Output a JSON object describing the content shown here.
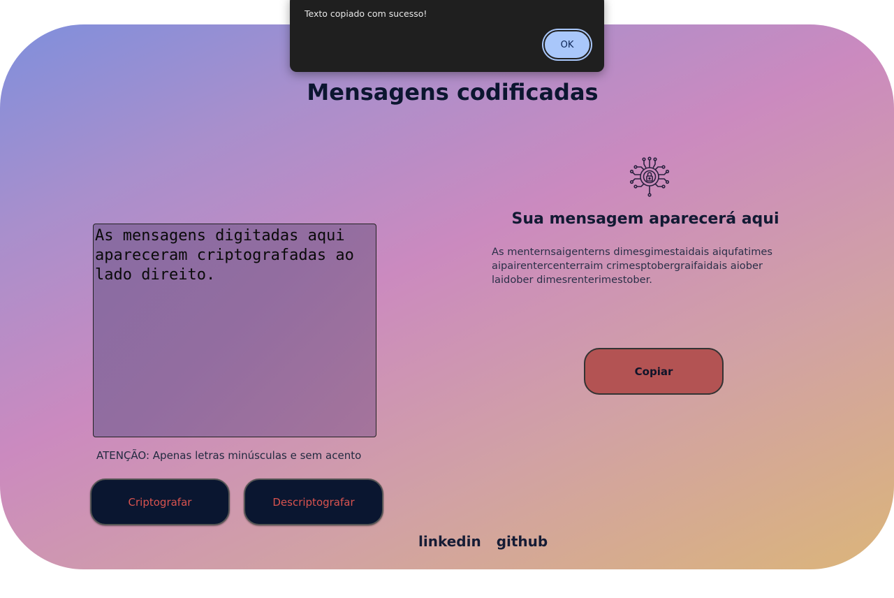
{
  "page": {
    "title": "Mensagens codificadas"
  },
  "input": {
    "value": "As mensagens digitadas aqui apareceram criptografadas ao lado direito."
  },
  "warning": "ATENÇÃO: Apenas letras minúsculas e sem acento",
  "buttons": {
    "encrypt": "Criptografar",
    "decrypt": "Descriptografar",
    "copy": "Copiar"
  },
  "result": {
    "icon": "circuit-lock-icon",
    "title": "Sua mensagem aparecerá aqui",
    "text": "As menternsaigenterns dimesgimestaidais aiqufatimes aipairentercenterraim crimesptobergraifaidais aiober laidober dimesrenterimestober."
  },
  "footer": {
    "links": [
      "linkedin",
      "github"
    ]
  },
  "dialog": {
    "message": "Texto copiado com sucesso!",
    "ok_label": "OK"
  },
  "colors": {
    "dark_button": "#0a1630",
    "dark_button_text": "#d9534f",
    "copy_button": "#b35353",
    "dialog_bg": "#1f1f1f",
    "dialog_ok": "#a9c7fa"
  }
}
